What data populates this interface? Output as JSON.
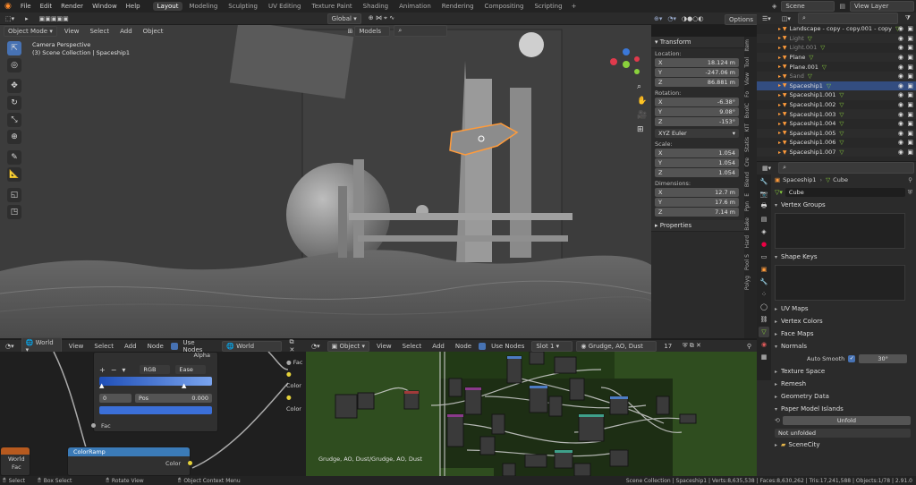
{
  "topbar": {
    "menus": [
      "File",
      "Edit",
      "Render",
      "Window",
      "Help"
    ],
    "workspaces": [
      "Layout",
      "Modeling",
      "Sculpting",
      "UV Editing",
      "Texture Paint",
      "Shading",
      "Animation",
      "Rendering",
      "Compositing",
      "Scripting"
    ],
    "active_workspace": "Layout",
    "scene": "Scene",
    "view_layer": "View Layer"
  },
  "viewport_header": {
    "mode": "Object Mode",
    "menus": [
      "View",
      "Select",
      "Add",
      "Object"
    ],
    "orientation": "Global",
    "options": "Options",
    "collection_filter": "Models"
  },
  "viewport": {
    "camera_label": "Camera Perspective",
    "collection_label": "(3) Scene Collection | Spaceship1"
  },
  "npanel": {
    "transform_title": "Transform",
    "location_label": "Location:",
    "location": [
      {
        "axis": "X",
        "value": "18.124 m"
      },
      {
        "axis": "Y",
        "value": "-247.06 m"
      },
      {
        "axis": "Z",
        "value": "86.881 m"
      }
    ],
    "rotation_label": "Rotation:",
    "rotation": [
      {
        "axis": "X",
        "value": "-6.38°"
      },
      {
        "axis": "Y",
        "value": "9.08°"
      },
      {
        "axis": "Z",
        "value": "-153°"
      }
    ],
    "rotation_mode": "XYZ Euler",
    "scale_label": "Scale:",
    "scale": [
      {
        "axis": "X",
        "value": "1.054"
      },
      {
        "axis": "Y",
        "value": "1.054"
      },
      {
        "axis": "Z",
        "value": "1.054"
      }
    ],
    "dimensions_label": "Dimensions:",
    "dimensions": [
      {
        "axis": "X",
        "value": "12.7 m"
      },
      {
        "axis": "Y",
        "value": "17.6 m"
      },
      {
        "axis": "Z",
        "value": "7.14 m"
      }
    ],
    "properties_title": "Properties",
    "tabs": [
      "Item",
      "Tool",
      "View",
      "Fo",
      "BoolC",
      "KIT",
      "Statis",
      "Cre",
      "Blend",
      "E",
      "Ppn",
      "Bake",
      "Hard",
      "Pool S",
      "Polyg"
    ]
  },
  "outliner": {
    "rows": [
      {
        "name": "Landscape - copy - copy.001 - copy",
        "state": "normal"
      },
      {
        "name": "Light",
        "state": "dim"
      },
      {
        "name": "Light.001",
        "state": "dim"
      },
      {
        "name": "Plane",
        "state": "normal"
      },
      {
        "name": "Plane.001",
        "state": "normal"
      },
      {
        "name": "Sand",
        "state": "dim"
      },
      {
        "name": "Spaceship1",
        "state": "sel"
      },
      {
        "name": "Spaceship1.001",
        "state": "normal"
      },
      {
        "name": "Spaceship1.002",
        "state": "normal"
      },
      {
        "name": "Spaceship1.003",
        "state": "normal"
      },
      {
        "name": "Spaceship1.004",
        "state": "normal"
      },
      {
        "name": "Spaceship1.005",
        "state": "normal"
      },
      {
        "name": "Spaceship1.006",
        "state": "normal"
      },
      {
        "name": "Spaceship1.007",
        "state": "normal"
      }
    ]
  },
  "properties": {
    "breadcrumb_object": "Spaceship1",
    "breadcrumb_data": "Cube",
    "mesh_name": "Cube",
    "sections": {
      "vertex_groups": "Vertex Groups",
      "shape_keys": "Shape Keys",
      "uv_maps": "UV Maps",
      "vertex_colors": "Vertex Colors",
      "face_maps": "Face Maps",
      "normals": "Normals",
      "auto_smooth": "Auto Smooth",
      "auto_smooth_angle": "30°",
      "texture_space": "Texture Space",
      "remesh": "Remesh",
      "geometry_data": "Geometry Data",
      "paper_model": "Paper Model Islands",
      "unfold": "Unfold",
      "not_unfolded": "Not unfolded",
      "scene_city": "SceneCity"
    }
  },
  "node_left": {
    "type": "World",
    "menus": [
      "View",
      "Select",
      "Add",
      "Node"
    ],
    "use_nodes": "Use Nodes",
    "world_name": "World",
    "ramp_mode": "RGB",
    "ramp_interp": "Ease",
    "ramp_index": "0",
    "ramp_pos_label": "Pos",
    "ramp_pos_value": "0.000",
    "fac": "Fac",
    "alpha": "Alpha",
    "color": "Color",
    "colorramp_title": "ColorRamp",
    "world_node": "World",
    "fac2": "Fac",
    "color_out": "Color"
  },
  "node_right": {
    "type": "Object",
    "menus": [
      "View",
      "Select",
      "Add",
      "Node"
    ],
    "use_nodes": "Use Nodes",
    "slot": "Slot 1",
    "material": "Grudge, AO, Dust",
    "users": "17",
    "frame_label": "Grudge, AO, Dust/Grudge, AO, Dust"
  },
  "statusbar": {
    "select": "Select",
    "box_select": "Box Select",
    "rotate_view": "Rotate View",
    "context_menu": "Object Context Menu",
    "stats": "Scene Collection | Spaceship1 | Verts:8,635,538 | Faces:8,630,262 | Tris:17,241,588 | Objects:1/78 | 2.91.0"
  },
  "colors": {
    "accent": "#4772b3",
    "selection_orange": "#ff9b3b",
    "node_bg_green": "#2f4d1f",
    "ramp_blue": "#3b6fd8"
  }
}
